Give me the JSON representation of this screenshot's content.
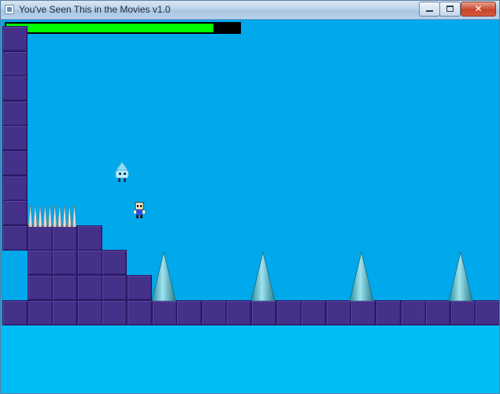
{
  "window": {
    "title": "You've Seen This in the Movies v1.0",
    "icon": "app-window-icon",
    "buttons": {
      "minimize_icon": "minimize-icon",
      "maximize_icon": "maximize-icon",
      "close_icon": "close-icon"
    }
  },
  "game": {
    "health": {
      "value": 0.89,
      "fill_color": "#00ff00",
      "track_color": "#000000"
    },
    "colors": {
      "sky": "#00a8ec",
      "block": "#45308a",
      "floor_water": "#00bcf4",
      "spike": "#4fb7c7"
    },
    "entities": [
      {
        "name": "ghost-enemy",
        "icon": "ghost-icon"
      },
      {
        "name": "player-character",
        "icon": "player-icon"
      },
      {
        "name": "spike-trap",
        "icon": "spike-row-icon"
      }
    ],
    "cone_spike_count": 4
  }
}
